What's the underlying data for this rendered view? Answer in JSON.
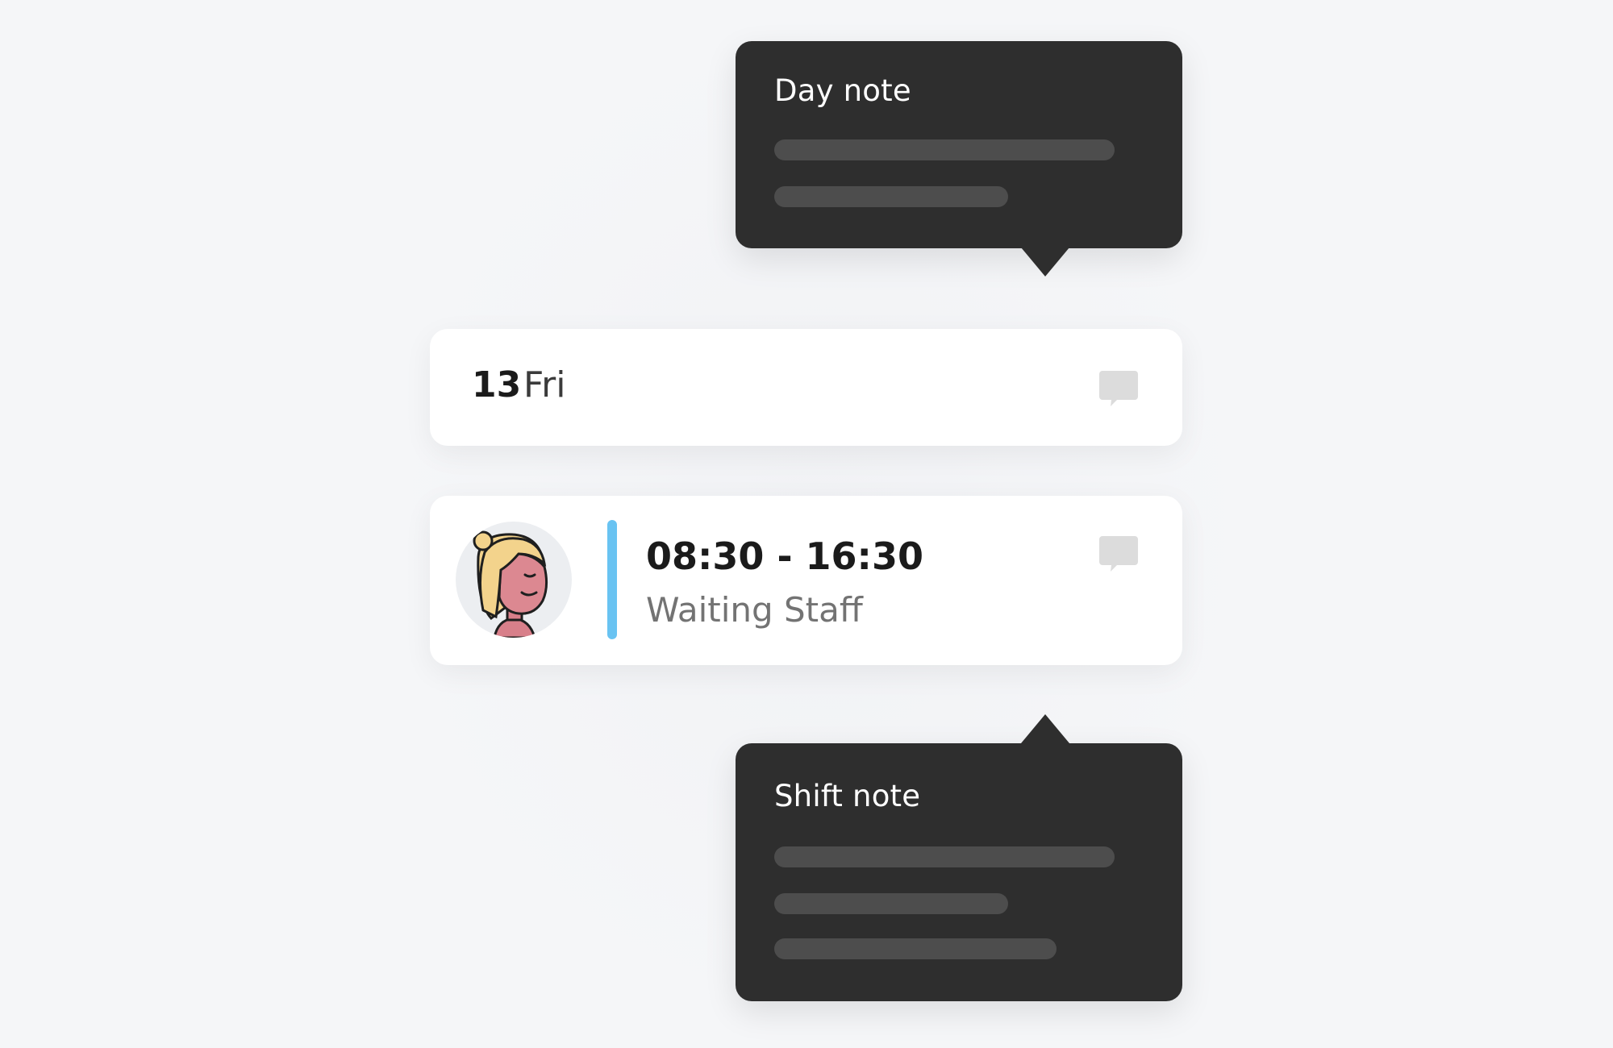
{
  "day_note": {
    "title": "Day note"
  },
  "day_header": {
    "date_number": "13",
    "day_name": "Fri",
    "note_icon": "comment-icon"
  },
  "shift_card": {
    "avatar_icon": "user-avatar-illustration",
    "time_range": "08:30 - 16:30",
    "role": "Waiting Staff",
    "role_color": "#69c3f2",
    "note_icon": "comment-icon"
  },
  "shift_note": {
    "title": "Shift note"
  },
  "colors": {
    "popover_background": "#2e2e2e",
    "skeleton_line": "#4d4d4d",
    "card_background": "#ffffff",
    "page_background": "#f5f6f8"
  }
}
